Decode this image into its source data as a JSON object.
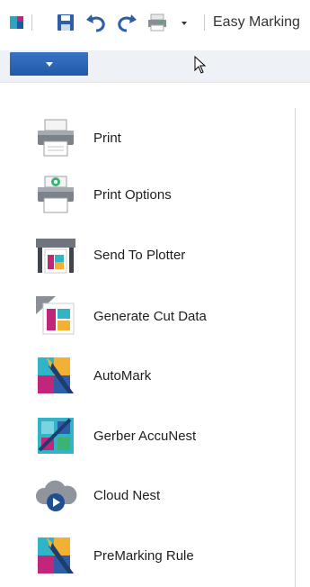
{
  "toolbar": {
    "title": "Easy Marking",
    "icons": [
      "app-logo-icon",
      "save-icon",
      "undo-icon",
      "redo-icon",
      "print-icon",
      "customize-dropdown-icon"
    ]
  },
  "ribbon": {
    "file_tab_icon": "chevron-down-icon"
  },
  "menu": {
    "items": [
      {
        "label": "Print",
        "icon": "printer-icon"
      },
      {
        "label": "Print Options",
        "icon": "print-options-icon"
      },
      {
        "label": "Send To Plotter",
        "icon": "plotter-icon"
      },
      {
        "label": "Generate Cut Data",
        "icon": "cut-data-icon"
      },
      {
        "label": "AutoMark",
        "icon": "automark-icon"
      },
      {
        "label": "Gerber AccuNest",
        "icon": "accunest-icon"
      },
      {
        "label": "Cloud Nest",
        "icon": "cloud-nest-icon"
      },
      {
        "label": "PreMarking Rule",
        "icon": "premarking-rule-icon"
      }
    ]
  },
  "colors": {
    "file_tab": "#2a64b4",
    "accent_blue": "#2d5fa8",
    "magenta": "#c0267a",
    "cyan": "#31b4c8",
    "yellow": "#f2b134"
  }
}
